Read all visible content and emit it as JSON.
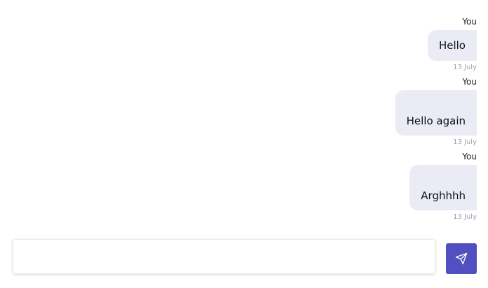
{
  "messages": [
    {
      "sender": "You",
      "text": "Hello",
      "time": "13 July"
    },
    {
      "sender": "You",
      "text": "Hello again",
      "time": "13 July"
    },
    {
      "sender": "You",
      "text": "Arghhhh",
      "time": "13 July"
    }
  ],
  "composer": {
    "value": "",
    "placeholder": ""
  },
  "icons": {
    "send": "send-icon"
  },
  "colors": {
    "bubble": "#ebebf6",
    "accent": "#5050c0",
    "timestamp": "#a0a0a8"
  }
}
